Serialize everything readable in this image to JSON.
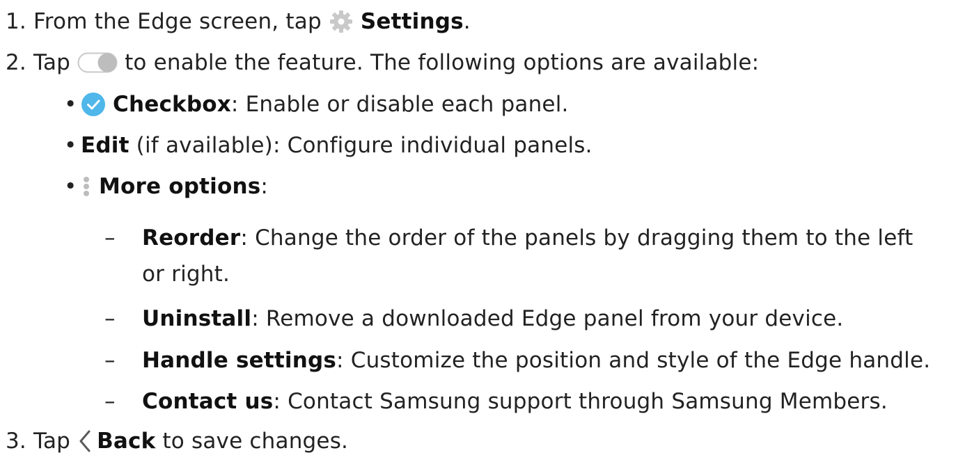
{
  "steps": [
    {
      "number": "1.",
      "pre": "From the Edge screen, tap",
      "icon": "gear-icon",
      "strong": "Settings",
      "post": "."
    },
    {
      "number": "2.",
      "pre": "Tap",
      "icon": "toggle-icon",
      "post": "to enable the feature. The following options are available:",
      "bullets": [
        {
          "icon": "check-circle-icon",
          "strong": "Checkbox",
          "text": ": Enable or disable each panel."
        },
        {
          "strong": "Edit",
          "text": " (if available): Configure individual panels."
        },
        {
          "icon": "more-vertical-icon",
          "strong": "More options",
          "text": ":",
          "subitems": [
            {
              "strong": "Reorder",
              "text_line1": ": Change the order of the panels by dragging them to the left",
              "text_line2": "or right."
            },
            {
              "strong": "Uninstall",
              "text": ": Remove a downloaded Edge panel from your device."
            },
            {
              "strong": "Handle settings",
              "text": ": Customize the position and style of the Edge handle."
            },
            {
              "strong": "Contact us",
              "text": ": Contact Samsung support through Samsung Members."
            }
          ]
        }
      ]
    },
    {
      "number": "3.",
      "pre": "Tap",
      "icon": "chevron-left-icon",
      "strong": "Back",
      "post": "to save changes."
    }
  ],
  "colors": {
    "text": "#222222",
    "gear_icon": "#c9c9c9",
    "toggle_icon": "#c8c8c8",
    "check_icon": "#4fb7ea",
    "more_icon": "#bdbdbd"
  }
}
